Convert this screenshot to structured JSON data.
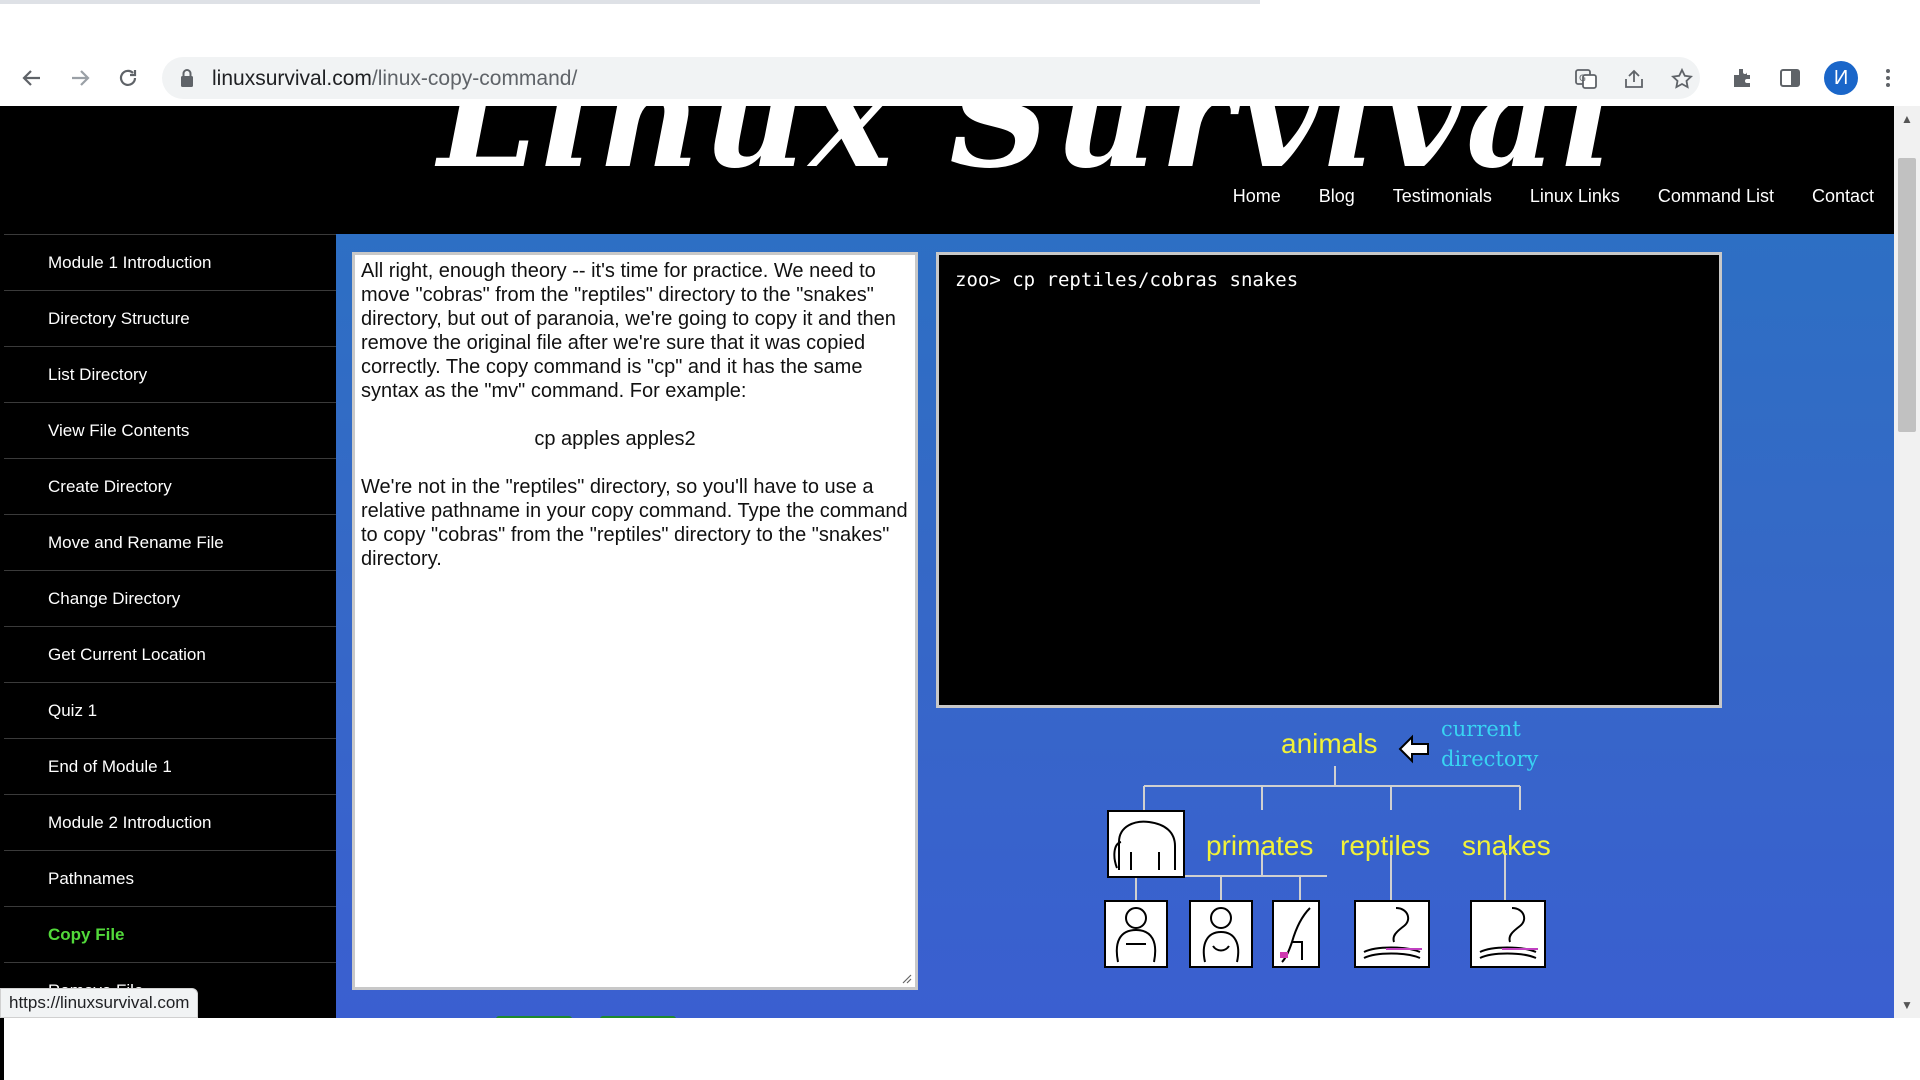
{
  "browser": {
    "url_domain": "linuxsurvival.com",
    "url_path": "/linux-copy-command/",
    "avatar_letter": "И",
    "status_url": "https://linuxsurvival.com"
  },
  "site": {
    "logo_text": "Linux Survival",
    "nav": [
      "Home",
      "Blog",
      "Testimonials",
      "Linux Links",
      "Command List",
      "Contact"
    ]
  },
  "sidebar": {
    "items": [
      {
        "label": "Module 1 Introduction"
      },
      {
        "label": "Directory Structure"
      },
      {
        "label": "List Directory"
      },
      {
        "label": "View File Contents"
      },
      {
        "label": "Create Directory"
      },
      {
        "label": "Move and Rename File"
      },
      {
        "label": "Change Directory"
      },
      {
        "label": "Get Current Location"
      },
      {
        "label": "Quiz 1"
      },
      {
        "label": "End of Module 1"
      },
      {
        "label": "Module 2 Introduction"
      },
      {
        "label": "Pathnames"
      },
      {
        "label": "Copy File",
        "active": true
      },
      {
        "label": "Remove File"
      }
    ]
  },
  "lesson": {
    "p1": "All right, enough theory -- it's time for practice. We need to move \"cobras\" from the \"reptiles\" directory to the \"snakes\" directory, but out of paranoia, we're going to copy it and then remove the original file after we're sure that it was copied correctly. The copy command is \"cp\" and it has the same syntax as the \"mv\" command. For example:",
    "example": "cp apples apples2",
    "p2": "We're not in the \"reptiles\" directory, so you'll have to use a relative pathname in your copy command. Type the command to copy \"cobras\" from the \"reptiles\" directory to the \"snakes\" directory."
  },
  "terminal": {
    "line": "zoo> cp reptiles/cobras snakes"
  },
  "tree": {
    "root": "animals",
    "current_line1": "current",
    "current_line2": "directory",
    "children": [
      "primates",
      "reptiles",
      "snakes"
    ]
  },
  "colors": {
    "accent_green": "#52d93a",
    "tree_label": "#f2f238",
    "current_dir": "#38d4f2",
    "content_bg": "#3569c6"
  }
}
